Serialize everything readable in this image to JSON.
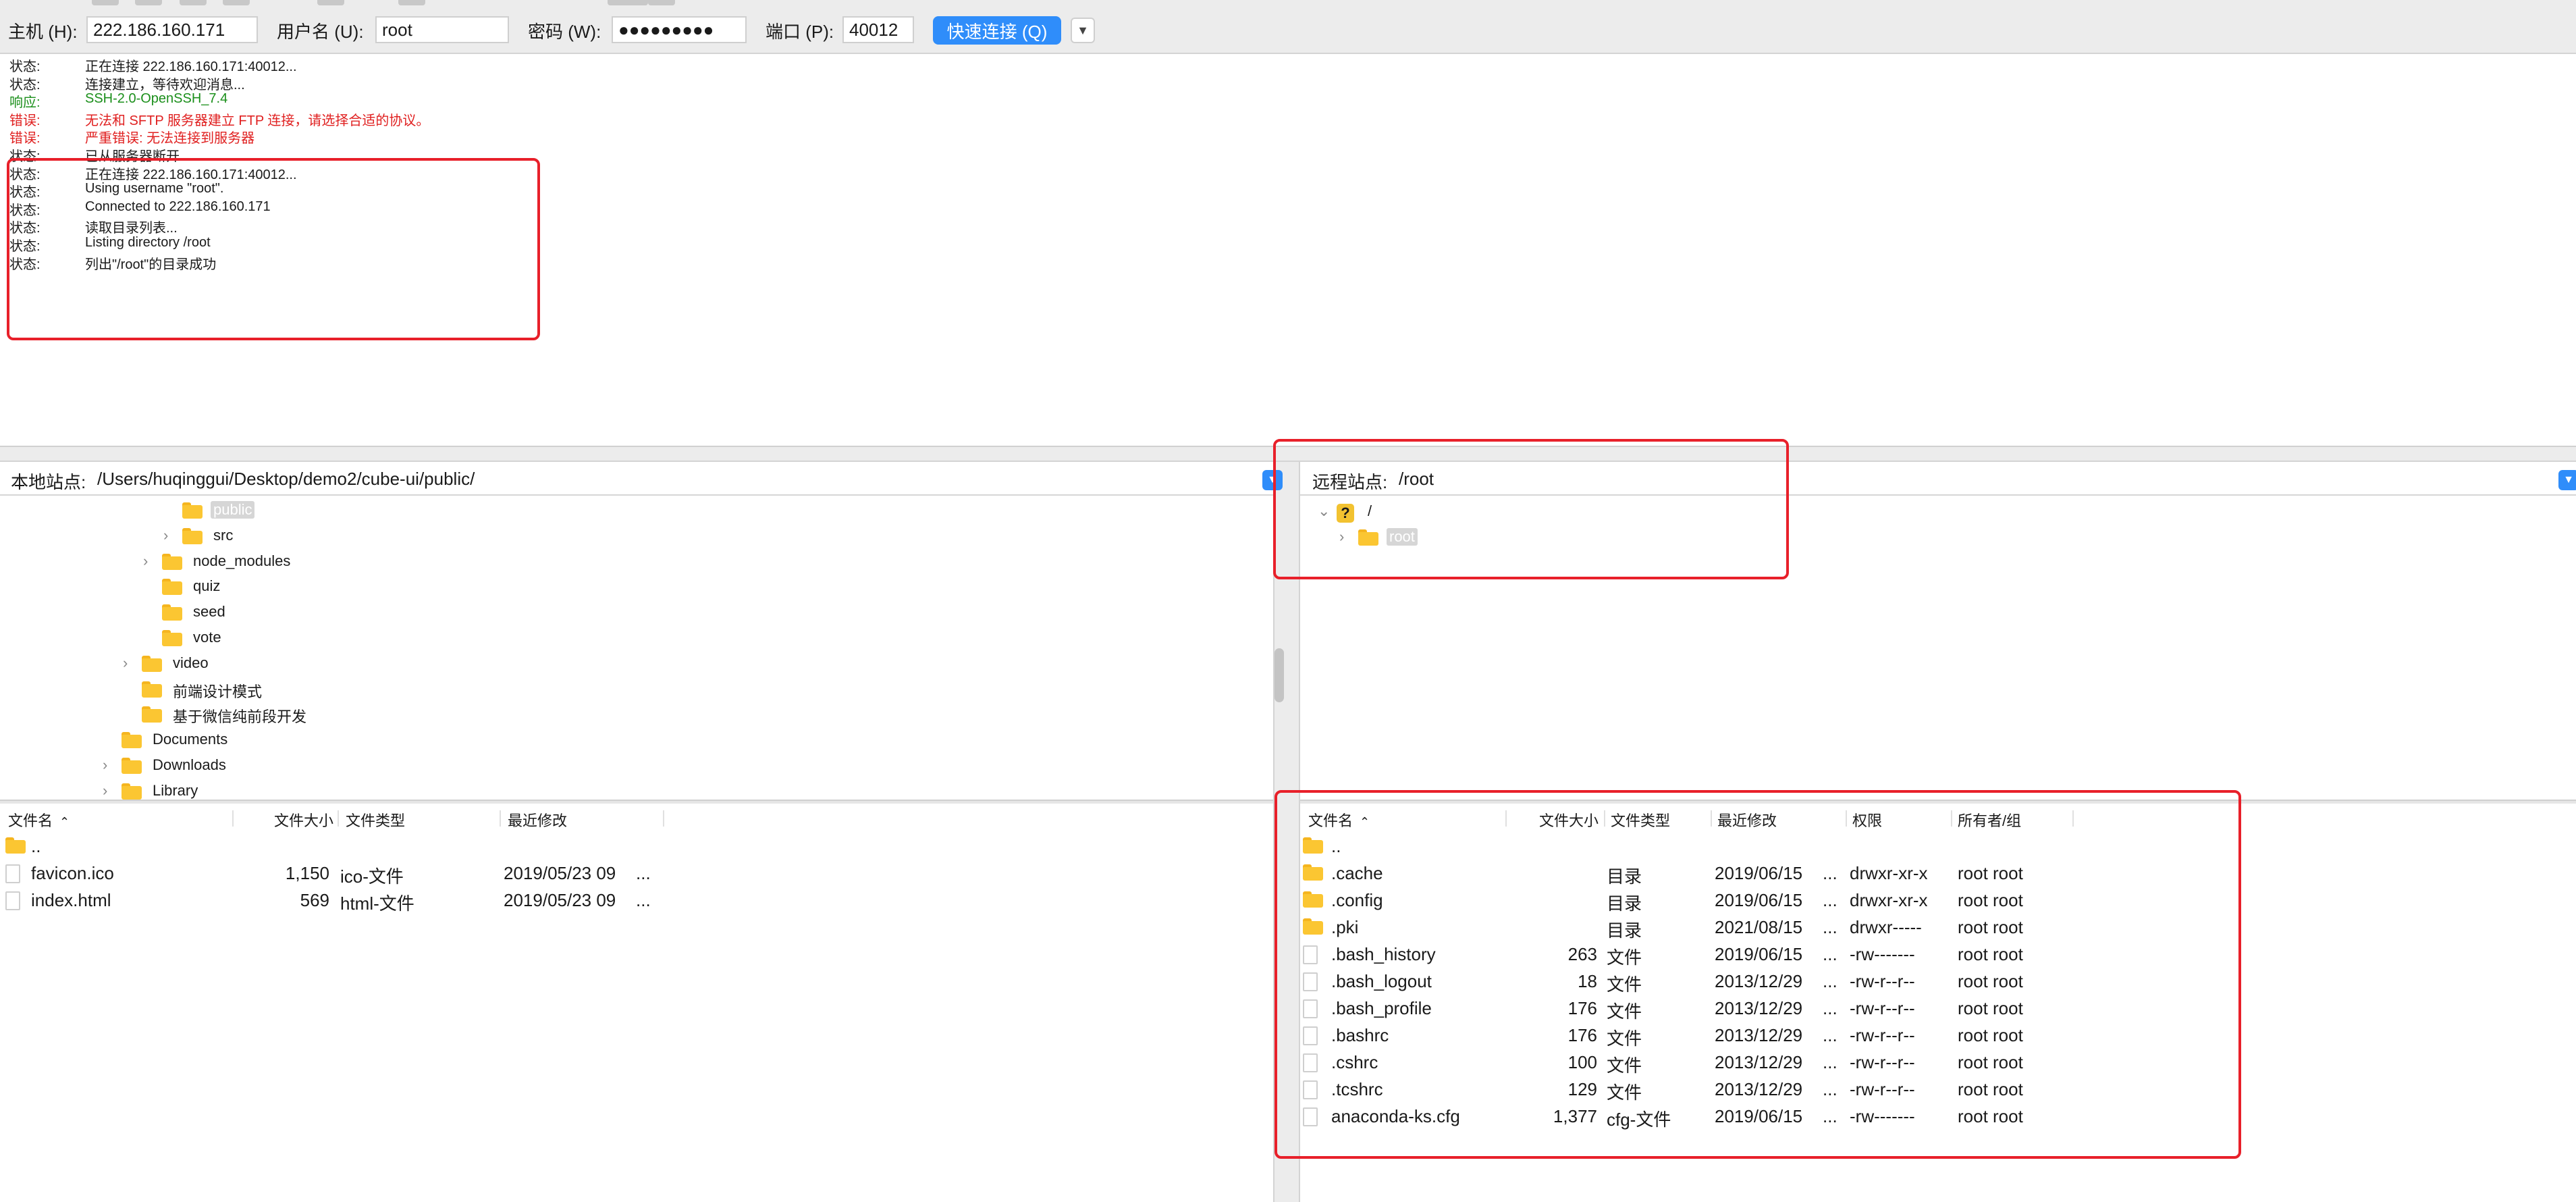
{
  "colors": {
    "toolbar_bg": "#ececec",
    "accent": "#2f8dfa",
    "status_text": "#1a1a1a",
    "response_text": "#1b8f1b",
    "error_text": "#e02020",
    "annotation": "#e8202a",
    "folder": "#fbc632"
  },
  "quickconnect": {
    "host_label": "主机 (H):",
    "host_value": "222.186.160.171",
    "user_label": "用户名 (U):",
    "user_value": "root",
    "password_label": "密码 (W):",
    "password_value": "●●●●●●●●●",
    "port_label": "端口 (P):",
    "port_value": "40012",
    "connect_label": "快速连接 (Q)",
    "dropdown_icon": "chevron-down-icon"
  },
  "log": [
    {
      "kind": "状态:",
      "text": "正在连接 222.186.160.171:40012...",
      "type": "status"
    },
    {
      "kind": "状态:",
      "text": "连接建立，等待欢迎消息...",
      "type": "status"
    },
    {
      "kind": "响应:",
      "text": "SSH-2.0-OpenSSH_7.4",
      "type": "response"
    },
    {
      "kind": "错误:",
      "text": "无法和 SFTP 服务器建立 FTP 连接，请选择合适的协议。",
      "type": "error"
    },
    {
      "kind": "错误:",
      "text": "严重错误: 无法连接到服务器",
      "type": "error"
    },
    {
      "kind": "状态:",
      "text": "已从服务器断开",
      "type": "status"
    },
    {
      "kind": "状态:",
      "text": "正在连接 222.186.160.171:40012...",
      "type": "status"
    },
    {
      "kind": "状态:",
      "text": "Using username \"root\".",
      "type": "status"
    },
    {
      "kind": "状态:",
      "text": "Connected to 222.186.160.171",
      "type": "status"
    },
    {
      "kind": "状态:",
      "text": "读取目录列表...",
      "type": "status"
    },
    {
      "kind": "状态:",
      "text": "Listing directory /root",
      "type": "status"
    },
    {
      "kind": "状态:",
      "text": "列出\"/root\"的目录成功",
      "type": "status"
    }
  ],
  "local": {
    "site_label": "本地站点:",
    "site_path": "/Users/huqinggui/Desktop/demo2/cube-ui/public/",
    "tree": [
      {
        "label": "public",
        "indent": 6,
        "chevron": "",
        "selected": true
      },
      {
        "label": "src",
        "indent": 6,
        "chevron": "›",
        "selected": false
      },
      {
        "label": "node_modules",
        "indent": 5,
        "chevron": "›",
        "selected": false
      },
      {
        "label": "quiz",
        "indent": 5,
        "chevron": "",
        "selected": false
      },
      {
        "label": "seed",
        "indent": 5,
        "chevron": "",
        "selected": false
      },
      {
        "label": "vote",
        "indent": 5,
        "chevron": "",
        "selected": false
      },
      {
        "label": "video",
        "indent": 4,
        "chevron": "›",
        "selected": false
      },
      {
        "label": "前端设计模式",
        "indent": 4,
        "chevron": "",
        "selected": false
      },
      {
        "label": "基于微信纯前段开发",
        "indent": 4,
        "chevron": "",
        "selected": false
      },
      {
        "label": "Documents",
        "indent": 3,
        "chevron": "",
        "selected": false
      },
      {
        "label": "Downloads",
        "indent": 3,
        "chevron": "›",
        "selected": false
      },
      {
        "label": "Library",
        "indent": 3,
        "chevron": "›",
        "selected": false
      }
    ],
    "columns": {
      "name": "文件名",
      "size": "文件大小",
      "type": "文件类型",
      "modified": "最近修改"
    },
    "files": [
      {
        "name": "..",
        "size": "",
        "type": "",
        "modified": "",
        "is_dir": true
      },
      {
        "name": "favicon.ico",
        "size": "1,150",
        "type": "ico-文件",
        "modified": "2019/05/23 09",
        "ellipsis": "...",
        "is_dir": false
      },
      {
        "name": "index.html",
        "size": "569",
        "type": "html-文件",
        "modified": "2019/05/23 09",
        "ellipsis": "...",
        "is_dir": false
      }
    ]
  },
  "remote": {
    "site_label": "远程站点:",
    "site_path": "/root",
    "tree": [
      {
        "label": "/",
        "chevron": "⌄",
        "icon": "question-icon",
        "indent": 0
      },
      {
        "label": "root",
        "chevron": "›",
        "icon": "folder-icon",
        "indent": 1
      }
    ],
    "columns": {
      "name": "文件名",
      "size": "文件大小",
      "type": "文件类型",
      "modified": "最近修改",
      "perms": "权限",
      "owner": "所有者/组"
    },
    "files": [
      {
        "name": "..",
        "size": "",
        "type": "",
        "modified": "",
        "ellipsis": "",
        "perms": "",
        "owner": "",
        "is_dir": true
      },
      {
        "name": ".cache",
        "size": "",
        "type": "目录",
        "modified": "2019/06/15",
        "ellipsis": "...",
        "perms": "drwxr-xr-x",
        "owner": "root root",
        "is_dir": true
      },
      {
        "name": ".config",
        "size": "",
        "type": "目录",
        "modified": "2019/06/15",
        "ellipsis": "...",
        "perms": "drwxr-xr-x",
        "owner": "root root",
        "is_dir": true
      },
      {
        "name": ".pki",
        "size": "",
        "type": "目录",
        "modified": "2021/08/15",
        "ellipsis": "...",
        "perms": "drwxr-----",
        "owner": "root root",
        "is_dir": true
      },
      {
        "name": ".bash_history",
        "size": "263",
        "type": "文件",
        "modified": "2019/06/15",
        "ellipsis": "...",
        "perms": "-rw-------",
        "owner": "root root",
        "is_dir": false
      },
      {
        "name": ".bash_logout",
        "size": "18",
        "type": "文件",
        "modified": "2013/12/29",
        "ellipsis": "...",
        "perms": "-rw-r--r--",
        "owner": "root root",
        "is_dir": false
      },
      {
        "name": ".bash_profile",
        "size": "176",
        "type": "文件",
        "modified": "2013/12/29",
        "ellipsis": "...",
        "perms": "-rw-r--r--",
        "owner": "root root",
        "is_dir": false
      },
      {
        "name": ".bashrc",
        "size": "176",
        "type": "文件",
        "modified": "2013/12/29",
        "ellipsis": "...",
        "perms": "-rw-r--r--",
        "owner": "root root",
        "is_dir": false
      },
      {
        "name": ".cshrc",
        "size": "100",
        "type": "文件",
        "modified": "2013/12/29",
        "ellipsis": "...",
        "perms": "-rw-r--r--",
        "owner": "root root",
        "is_dir": false
      },
      {
        "name": ".tcshrc",
        "size": "129",
        "type": "文件",
        "modified": "2013/12/29",
        "ellipsis": "...",
        "perms": "-rw-r--r--",
        "owner": "root root",
        "is_dir": false
      },
      {
        "name": "anaconda-ks.cfg",
        "size": "1,377",
        "type": "cfg-文件",
        "modified": "2019/06/15",
        "ellipsis": "...",
        "perms": "-rw-------",
        "owner": "root root",
        "is_dir": false
      }
    ]
  }
}
